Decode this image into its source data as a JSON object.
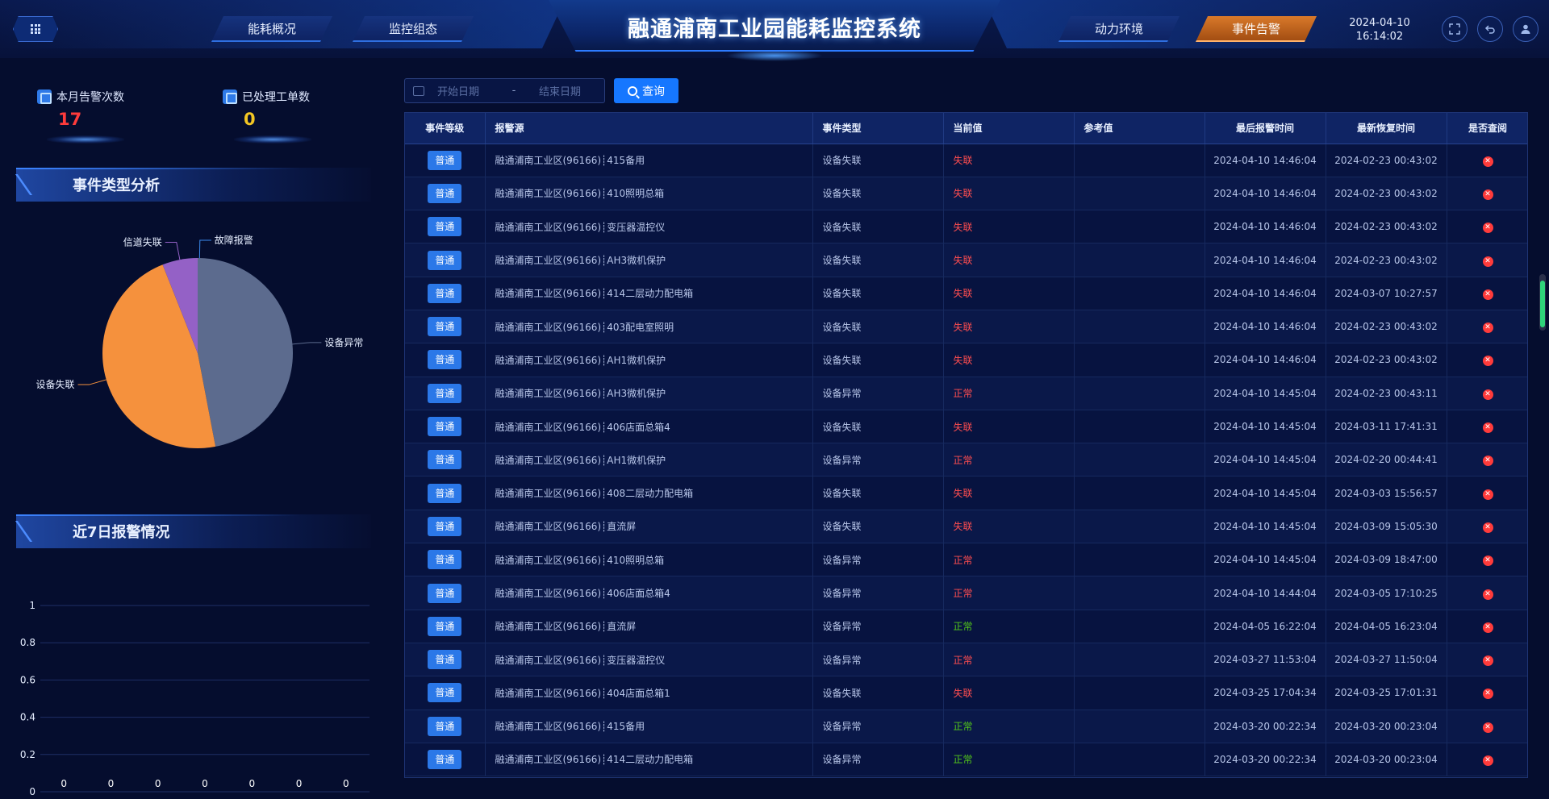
{
  "header": {
    "title": "融通浦南工业园能耗监控系统",
    "tabs": [
      {
        "label": "能耗概况",
        "active": false
      },
      {
        "label": "监控组态",
        "active": false
      },
      {
        "label": "动力环境",
        "active": false
      },
      {
        "label": "事件告警",
        "active": true
      }
    ],
    "date": "2024-04-10",
    "time": "16:14:02",
    "icons": [
      "grid-menu-icon",
      "fullscreen-icon",
      "back-icon",
      "user-icon"
    ]
  },
  "stats": {
    "alarms_this_month": {
      "label": "本月告警次数",
      "value": "17",
      "color": "#ff3b3b"
    },
    "processed_orders": {
      "label": "已处理工单数",
      "value": "0",
      "color": "#f3c623"
    }
  },
  "event_type_analysis": {
    "title": "事件类型分析",
    "chart_data": {
      "type": "pie",
      "slices": [
        {
          "label": "设备异常",
          "value": 47,
          "color": "#5c6b8e"
        },
        {
          "label": "设备失联",
          "value": 47,
          "color": "#f5913d"
        },
        {
          "label": "信道失联",
          "value": 6,
          "color": "#9461c6"
        },
        {
          "label": "故障报警",
          "value": 0,
          "color": "#3b8cf0"
        }
      ]
    }
  },
  "last7days": {
    "title": "近7日报警情况",
    "chart_data": {
      "type": "bar",
      "values": [
        0,
        0,
        0,
        0,
        0,
        0,
        0
      ],
      "ylim": [
        0,
        1
      ],
      "yticks": [
        "1",
        "0.8",
        "0.6",
        "0.4",
        "0.2",
        "0"
      ],
      "grid": true
    }
  },
  "toolbar": {
    "start_placeholder": "开始日期",
    "separator": "-",
    "end_placeholder": "结束日期",
    "query_label": "查询"
  },
  "table": {
    "headers": [
      "事件等级",
      "报警源",
      "事件类型",
      "当前值",
      "参考值",
      "最后报警时间",
      "最新恢复时间",
      "是否查阅"
    ],
    "status_colors": {
      "失联": "#ff4d4f",
      "正常_red": "#ff4d4f",
      "正常_green": "#52c41a"
    },
    "rows": [
      {
        "level": "普通",
        "source": "融通浦南工业区(96166)┊415备用",
        "type": "设备失联",
        "current": "失联",
        "current_color": "#ff4d4f",
        "ref": "",
        "last_alarm": "2024-04-10 14:46:04",
        "last_recover": "2024-02-23 00:43:02"
      },
      {
        "level": "普通",
        "source": "融通浦南工业区(96166)┊410照明总箱",
        "type": "设备失联",
        "current": "失联",
        "current_color": "#ff4d4f",
        "ref": "",
        "last_alarm": "2024-04-10 14:46:04",
        "last_recover": "2024-02-23 00:43:02"
      },
      {
        "level": "普通",
        "source": "融通浦南工业区(96166)┊变压器温控仪",
        "type": "设备失联",
        "current": "失联",
        "current_color": "#ff4d4f",
        "ref": "",
        "last_alarm": "2024-04-10 14:46:04",
        "last_recover": "2024-02-23 00:43:02"
      },
      {
        "level": "普通",
        "source": "融通浦南工业区(96166)┊AH3微机保护",
        "type": "设备失联",
        "current": "失联",
        "current_color": "#ff4d4f",
        "ref": "",
        "last_alarm": "2024-04-10 14:46:04",
        "last_recover": "2024-02-23 00:43:02"
      },
      {
        "level": "普通",
        "source": "融通浦南工业区(96166)┊414二层动力配电箱",
        "type": "设备失联",
        "current": "失联",
        "current_color": "#ff4d4f",
        "ref": "",
        "last_alarm": "2024-04-10 14:46:04",
        "last_recover": "2024-03-07 10:27:57"
      },
      {
        "level": "普通",
        "source": "融通浦南工业区(96166)┊403配电室照明",
        "type": "设备失联",
        "current": "失联",
        "current_color": "#ff4d4f",
        "ref": "",
        "last_alarm": "2024-04-10 14:46:04",
        "last_recover": "2024-02-23 00:43:02"
      },
      {
        "level": "普通",
        "source": "融通浦南工业区(96166)┊AH1微机保护",
        "type": "设备失联",
        "current": "失联",
        "current_color": "#ff4d4f",
        "ref": "",
        "last_alarm": "2024-04-10 14:46:04",
        "last_recover": "2024-02-23 00:43:02"
      },
      {
        "level": "普通",
        "source": "融通浦南工业区(96166)┊AH3微机保护",
        "type": "设备异常",
        "current": "正常",
        "current_color": "#ff4d4f",
        "ref": "",
        "last_alarm": "2024-04-10 14:45:04",
        "last_recover": "2024-02-23 00:43:11"
      },
      {
        "level": "普通",
        "source": "融通浦南工业区(96166)┊406店面总箱4",
        "type": "设备失联",
        "current": "失联",
        "current_color": "#ff4d4f",
        "ref": "",
        "last_alarm": "2024-04-10 14:45:04",
        "last_recover": "2024-03-11 17:41:31"
      },
      {
        "level": "普通",
        "source": "融通浦南工业区(96166)┊AH1微机保护",
        "type": "设备异常",
        "current": "正常",
        "current_color": "#ff4d4f",
        "ref": "",
        "last_alarm": "2024-04-10 14:45:04",
        "last_recover": "2024-02-20 00:44:41"
      },
      {
        "level": "普通",
        "source": "融通浦南工业区(96166)┊408二层动力配电箱",
        "type": "设备失联",
        "current": "失联",
        "current_color": "#ff4d4f",
        "ref": "",
        "last_alarm": "2024-04-10 14:45:04",
        "last_recover": "2024-03-03 15:56:57"
      },
      {
        "level": "普通",
        "source": "融通浦南工业区(96166)┊直流屏",
        "type": "设备失联",
        "current": "失联",
        "current_color": "#ff4d4f",
        "ref": "",
        "last_alarm": "2024-04-10 14:45:04",
        "last_recover": "2024-03-09 15:05:30"
      },
      {
        "level": "普通",
        "source": "融通浦南工业区(96166)┊410照明总箱",
        "type": "设备异常",
        "current": "正常",
        "current_color": "#ff4d4f",
        "ref": "",
        "last_alarm": "2024-04-10 14:45:04",
        "last_recover": "2024-03-09 18:47:00"
      },
      {
        "level": "普通",
        "source": "融通浦南工业区(96166)┊406店面总箱4",
        "type": "设备异常",
        "current": "正常",
        "current_color": "#ff4d4f",
        "ref": "",
        "last_alarm": "2024-04-10 14:44:04",
        "last_recover": "2024-03-05 17:10:25"
      },
      {
        "level": "普通",
        "source": "融通浦南工业区(96166)┊直流屏",
        "type": "设备异常",
        "current": "正常",
        "current_color": "#52c41a",
        "ref": "",
        "last_alarm": "2024-04-05 16:22:04",
        "last_recover": "2024-04-05 16:23:04"
      },
      {
        "level": "普通",
        "source": "融通浦南工业区(96166)┊变压器温控仪",
        "type": "设备异常",
        "current": "正常",
        "current_color": "#ff4d4f",
        "ref": "",
        "last_alarm": "2024-03-27 11:53:04",
        "last_recover": "2024-03-27 11:50:04"
      },
      {
        "level": "普通",
        "source": "融通浦南工业区(96166)┊404店面总箱1",
        "type": "设备失联",
        "current": "失联",
        "current_color": "#ff4d4f",
        "ref": "",
        "last_alarm": "2024-03-25 17:04:34",
        "last_recover": "2024-03-25 17:01:31"
      },
      {
        "level": "普通",
        "source": "融通浦南工业区(96166)┊415备用",
        "type": "设备异常",
        "current": "正常",
        "current_color": "#52c41a",
        "ref": "",
        "last_alarm": "2024-03-20 00:22:34",
        "last_recover": "2024-03-20 00:23:04"
      },
      {
        "level": "普通",
        "source": "融通浦南工业区(96166)┊414二层动力配电箱",
        "type": "设备异常",
        "current": "正常",
        "current_color": "#52c41a",
        "ref": "",
        "last_alarm": "2024-03-20 00:22:34",
        "last_recover": "2024-03-20 00:23:04"
      }
    ]
  }
}
